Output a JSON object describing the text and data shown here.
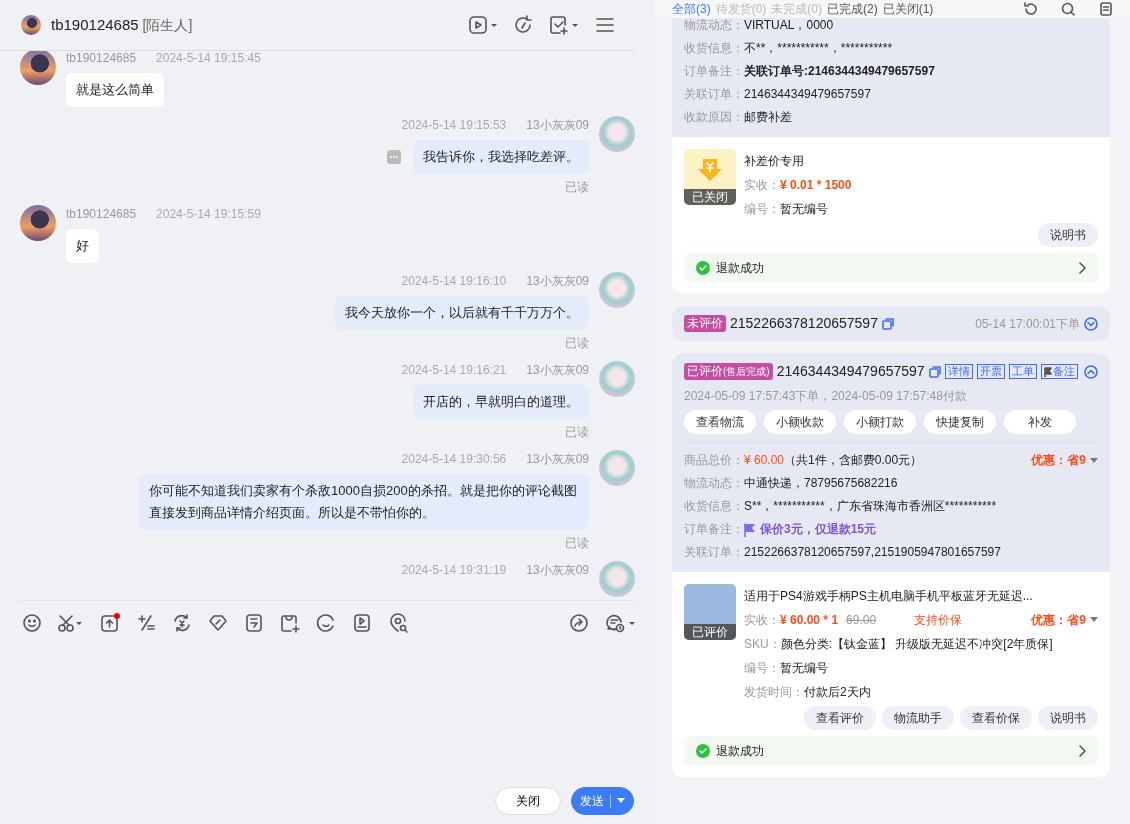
{
  "chat": {
    "contact": {
      "name": "tb190124685",
      "tag": "[陌生人]"
    },
    "messages": [
      {
        "kind": "incoming",
        "sender": "tb190124685",
        "time": "2024-5-14 19:15:45",
        "text": "就是这么简单"
      },
      {
        "kind": "outgoing",
        "sender": "13小灰灰09",
        "time": "2024-5-14 19:15:53",
        "text": "我告诉你，我选择吃差评。",
        "read": "已读",
        "more": true
      },
      {
        "kind": "incoming",
        "sender": "tb190124685",
        "time": "2024-5-14 19:15:59",
        "text": "好"
      },
      {
        "kind": "outgoing",
        "sender": "13小灰灰09",
        "time": "2024-5-14 19:16:10",
        "text": "我今天放你一个，以后就有千千万万个。",
        "read": "已读",
        "more": false
      },
      {
        "kind": "outgoing",
        "sender": "13小灰灰09",
        "time": "2024-5-14 19:16:21",
        "text": "开店的，早就明白的道理。",
        "read": "已读",
        "more": false
      },
      {
        "kind": "outgoing",
        "sender": "13小灰灰09",
        "time": "2024-5-14 19:30:56",
        "text": "你可能不知道我们卖家有个杀敌1000自损200的杀招。就是把你的评论截图直接发到商品详情介绍页面。所以是不带怕你的。",
        "read": "已读",
        "more": false
      },
      {
        "kind": "outgoing",
        "sender": "13小灰灰09",
        "time": "2024-5-14 19:31:19"
      }
    ],
    "buttons": [
      {
        "label": "关闭",
        "kind": "close"
      },
      {
        "label": "发送",
        "kind": "send"
      }
    ]
  },
  "orders_panel": {
    "tabs": [
      {
        "label": "全部(3)",
        "selected": true,
        "disabled": false
      },
      {
        "label": "待发货(0)",
        "selected": false,
        "disabled": true
      },
      {
        "label": "未完成(0)",
        "selected": false,
        "disabled": true
      },
      {
        "label": "已完成(2)",
        "selected": false,
        "disabled": false
      },
      {
        "label": "已关闭(1)",
        "selected": false,
        "disabled": false
      }
    ],
    "orders": [
      {
        "expanded": true,
        "info": [
          {
            "label": "物流动态：",
            "value": "VIRTUAL，0000",
            "kind": "plain"
          },
          {
            "label": "收货信息：",
            "value": "不**，***********，***********",
            "kind": "plain"
          },
          {
            "label": "订单备注：",
            "value": "关联订单号:2146344349479657597",
            "kind": "bold"
          },
          {
            "label": "关联订单：",
            "value": "2146344349479657597",
            "kind": "plain"
          },
          {
            "label": "收款原因：",
            "value": "邮费补差",
            "kind": "plain"
          }
        ],
        "item": {
          "kind": "coin",
          "title": "补差价专用",
          "status": "已关闭",
          "price_label": "实收：",
          "price": "¥ 0.01 * 1500",
          "rows": [
            {
              "label": "编号：",
              "value": "暂无编号"
            }
          ],
          "buttons": [
            "说明书"
          ],
          "refund": "退款成功"
        }
      },
      {
        "expanded": false,
        "tag": "未评价",
        "number": "2152266378120657597",
        "time": "05-14 17:00:01下单"
      },
      {
        "expanded": true,
        "tag": "已评价",
        "tag_sub": "(售后完成)",
        "number": "2146344349479657597",
        "links": [
          {
            "label": "详情",
            "kind": "text"
          },
          {
            "label": "开票",
            "kind": "text"
          },
          {
            "label": "工单",
            "kind": "text"
          },
          {
            "label": "备注",
            "kind": "flag"
          }
        ],
        "times": "2024-05-09 17:57:43下单，2024-05-09 17:57:48付款",
        "actions": [
          "查看物流",
          "小额收款",
          "小额打款",
          "快捷复制",
          "补发"
        ],
        "info": [
          {
            "label": "商品总价：",
            "value": "¥ 60.00",
            "extra": "（共1件，含邮费0.00元）",
            "discount": "优惠：省9",
            "kind": "price"
          },
          {
            "label": "物流动态：",
            "value": "中通快递，78795675682216",
            "kind": "plain"
          },
          {
            "label": "收货信息：",
            "value": "S**，***********，广东省珠海市香洲区***********",
            "kind": "plain"
          },
          {
            "label": "订单备注：",
            "value": "保价3元，仅退款15元",
            "kind": "flag"
          },
          {
            "label": "关联订单：",
            "value": "2152266378120657597,2151905947801657597",
            "kind": "plain"
          }
        ],
        "item": {
          "kind": "product",
          "title": "适用于PS4游戏手柄PS主机电脑手机平板蓝牙无延迟...",
          "status": "已评价",
          "price_label": "实收：",
          "price": "¥ 60.00 * 1",
          "original_price": "69.00",
          "guarantee": "支持价保",
          "discount": "优惠：省9",
          "rows": [
            {
              "label": "SKU：",
              "value": "颜色分类:【钛金蓝】 升级版无延迟不冲突[2年质保]"
            },
            {
              "label": "编号：",
              "value": "暂无编号"
            },
            {
              "label": "发货时间：",
              "value": "付款后2天内"
            }
          ],
          "buttons": [
            "查看评价",
            "物流助手",
            "查看价保",
            "说明书"
          ],
          "refund": "退款成功"
        }
      }
    ]
  }
}
